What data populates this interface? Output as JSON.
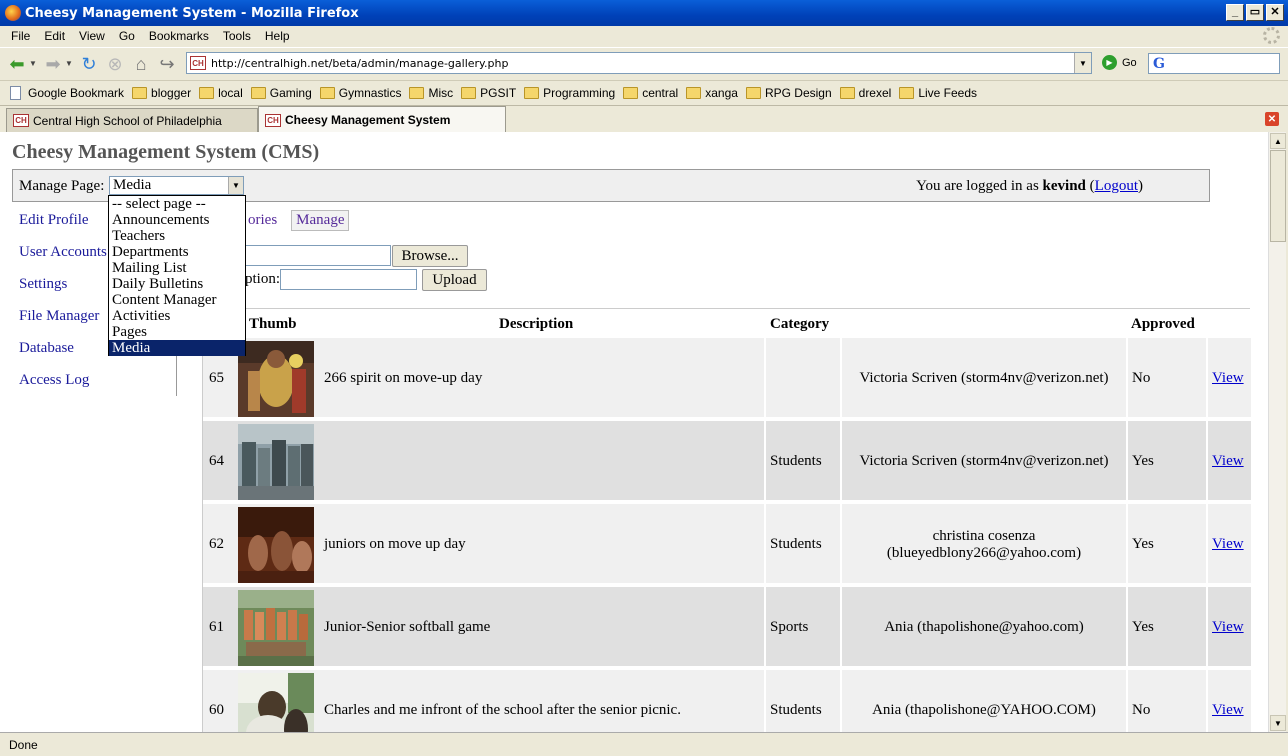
{
  "window": {
    "title": "Cheesy Management System - Mozilla Firefox",
    "buttons": [
      "_",
      "▭",
      "✕"
    ]
  },
  "menu": [
    "File",
    "Edit",
    "View",
    "Go",
    "Bookmarks",
    "Tools",
    "Help"
  ],
  "nav": {
    "url": "http://centralhigh.net/beta/admin/manage-gallery.php",
    "go_label": "Go",
    "favicon_text": "CH"
  },
  "bookmarks": [
    {
      "label": "Google Bookmark",
      "type": "page"
    },
    {
      "label": "blogger",
      "type": "folder"
    },
    {
      "label": "local",
      "type": "folder"
    },
    {
      "label": "Gaming",
      "type": "folder"
    },
    {
      "label": "Gymnastics",
      "type": "folder"
    },
    {
      "label": "Misc",
      "type": "folder"
    },
    {
      "label": "PGSIT",
      "type": "folder"
    },
    {
      "label": "Programming",
      "type": "folder"
    },
    {
      "label": "central",
      "type": "folder"
    },
    {
      "label": "xanga",
      "type": "folder"
    },
    {
      "label": "RPG Design",
      "type": "folder"
    },
    {
      "label": "drexel",
      "type": "folder"
    },
    {
      "label": "Live Feeds",
      "type": "folder"
    }
  ],
  "tabs": [
    {
      "label": "Central High School of Philadelphia",
      "active": false
    },
    {
      "label": "Cheesy Management System",
      "active": true
    }
  ],
  "page": {
    "title": "Cheesy Management System (CMS)",
    "manage_label": "Manage Page:",
    "manage_value": "Media",
    "logged_prefix": "You are logged in as",
    "username": "kevind",
    "logout": "Logout",
    "sidebar": [
      "Edit Profile",
      "User Accounts",
      "Settings",
      "File Manager",
      "Database",
      "Access Log"
    ],
    "sub_tabs": [
      "ories",
      "Manage"
    ],
    "browse_label": "Browse...",
    "caption_label": "ption:",
    "upload_label": "Upload",
    "columns": {
      "thumb": "Thumb",
      "description": "Description",
      "category": "Category",
      "approved": "Approved"
    },
    "rows": [
      {
        "id": "65",
        "description": "266 spirit on move-up day",
        "category": "",
        "submitter": "Victoria Scriven (storm4nv@verizon.net)",
        "approved": "No",
        "action": "View"
      },
      {
        "id": "64",
        "description": "",
        "category": "Students",
        "submitter": "Victoria Scriven (storm4nv@verizon.net)",
        "approved": "Yes",
        "action": "View"
      },
      {
        "id": "62",
        "description": "juniors on move up day",
        "category": "Students",
        "submitter": "christina cosenza (blueyedblony266@yahoo.com)",
        "approved": "Yes",
        "action": "View"
      },
      {
        "id": "61",
        "description": "Junior-Senior softball game",
        "category": "Sports",
        "submitter": "Ania (thapolishone@yahoo.com)",
        "approved": "Yes",
        "action": "View"
      },
      {
        "id": "60",
        "description": "Charles and me infront of the school after the senior picnic.",
        "category": "Students",
        "submitter": "Ania (thapolishone@YAHOO.COM)",
        "approved": "No",
        "action": "View"
      }
    ],
    "dropdown_options": [
      "-- select page --",
      "Announcements",
      "Teachers",
      "Departments",
      "Mailing List",
      "Daily Bulletins",
      "Content Manager",
      "Activities",
      "Pages",
      "Media"
    ]
  },
  "status": "Done"
}
